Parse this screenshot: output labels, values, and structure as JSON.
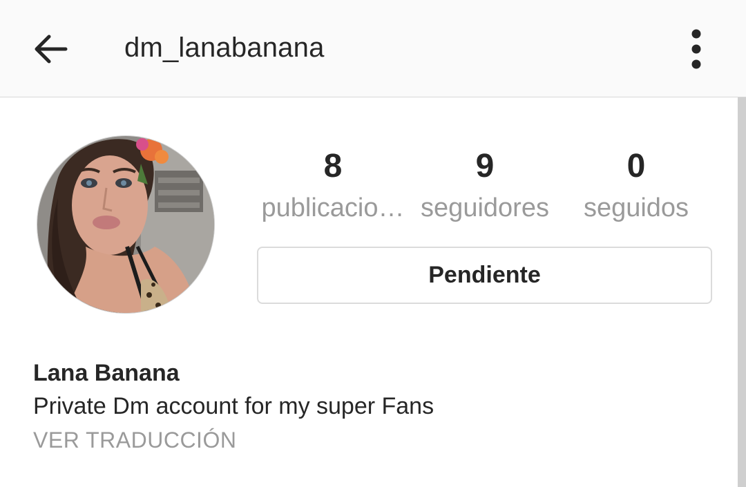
{
  "header": {
    "username": "dm_lanabanana",
    "back_icon": "arrow-left-icon",
    "menu_icon": "more-vertical-icon"
  },
  "profile": {
    "avatar": "profile-photo"
  },
  "stats": {
    "posts_count": "8",
    "posts_label": "publicacio…",
    "followers_count": "9",
    "followers_label": "seguidores",
    "following_count": "0",
    "following_label": "seguidos"
  },
  "actions": {
    "follow_status_label": "Pendiente"
  },
  "bio": {
    "name": "Lana Banana",
    "text": "Private Dm account for my super Fans",
    "translate_link": "VER TRADUCCIÓN"
  },
  "colors": {
    "header_bg": "#fafafa",
    "text_primary": "#262626",
    "text_secondary": "#9a9a9a",
    "border": "#dbdbdb"
  }
}
